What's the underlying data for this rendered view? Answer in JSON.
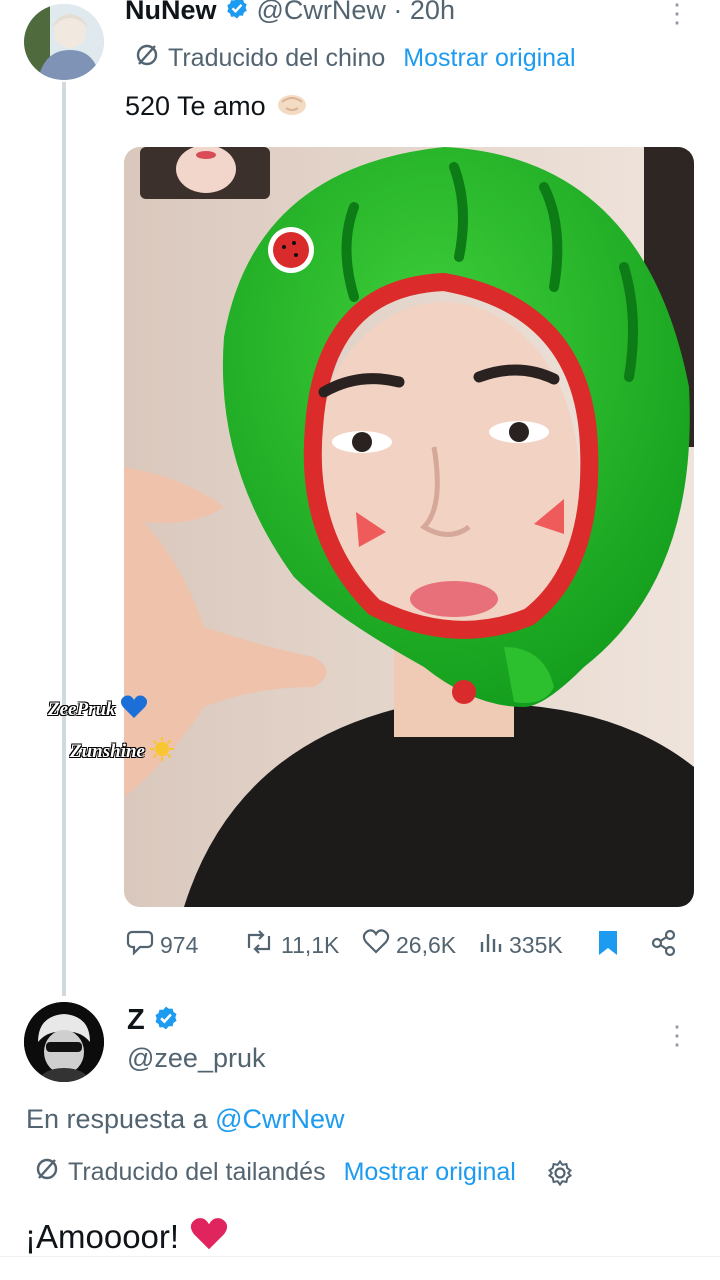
{
  "tweet1": {
    "author_name": "NuNew",
    "handle_time": "@CwrNew · 20h",
    "translated_label": "Traducido del chino",
    "show_original": "Mostrar original",
    "text": "520 Te amo",
    "stats": {
      "replies": "974",
      "reposts": "11,1K",
      "likes": "26,6K",
      "views": "335K"
    },
    "overlay": {
      "line1": "ZeePruk",
      "line2": "Zunshine"
    }
  },
  "tweet2": {
    "author_name": "Z",
    "handle": "@zee_pruk",
    "reply_prefix": "En respuesta a",
    "reply_to": "@CwrNew",
    "translated_label": "Traducido del tailandés",
    "show_original": "Mostrar original",
    "text": "¡Amoooor!"
  },
  "colors": {
    "accent": "#1d9bf0",
    "muted": "#536471",
    "heart": "#e0245e",
    "watermelon": "#22b327"
  },
  "icons": [
    "verified-icon",
    "translate-icon",
    "more-icon",
    "reply-icon",
    "repost-icon",
    "like-icon",
    "views-icon",
    "bookmark-icon",
    "share-icon",
    "settings-icon",
    "heart-emoji",
    "hands-emoji",
    "blue-heart-emoji",
    "sun-emoji"
  ]
}
